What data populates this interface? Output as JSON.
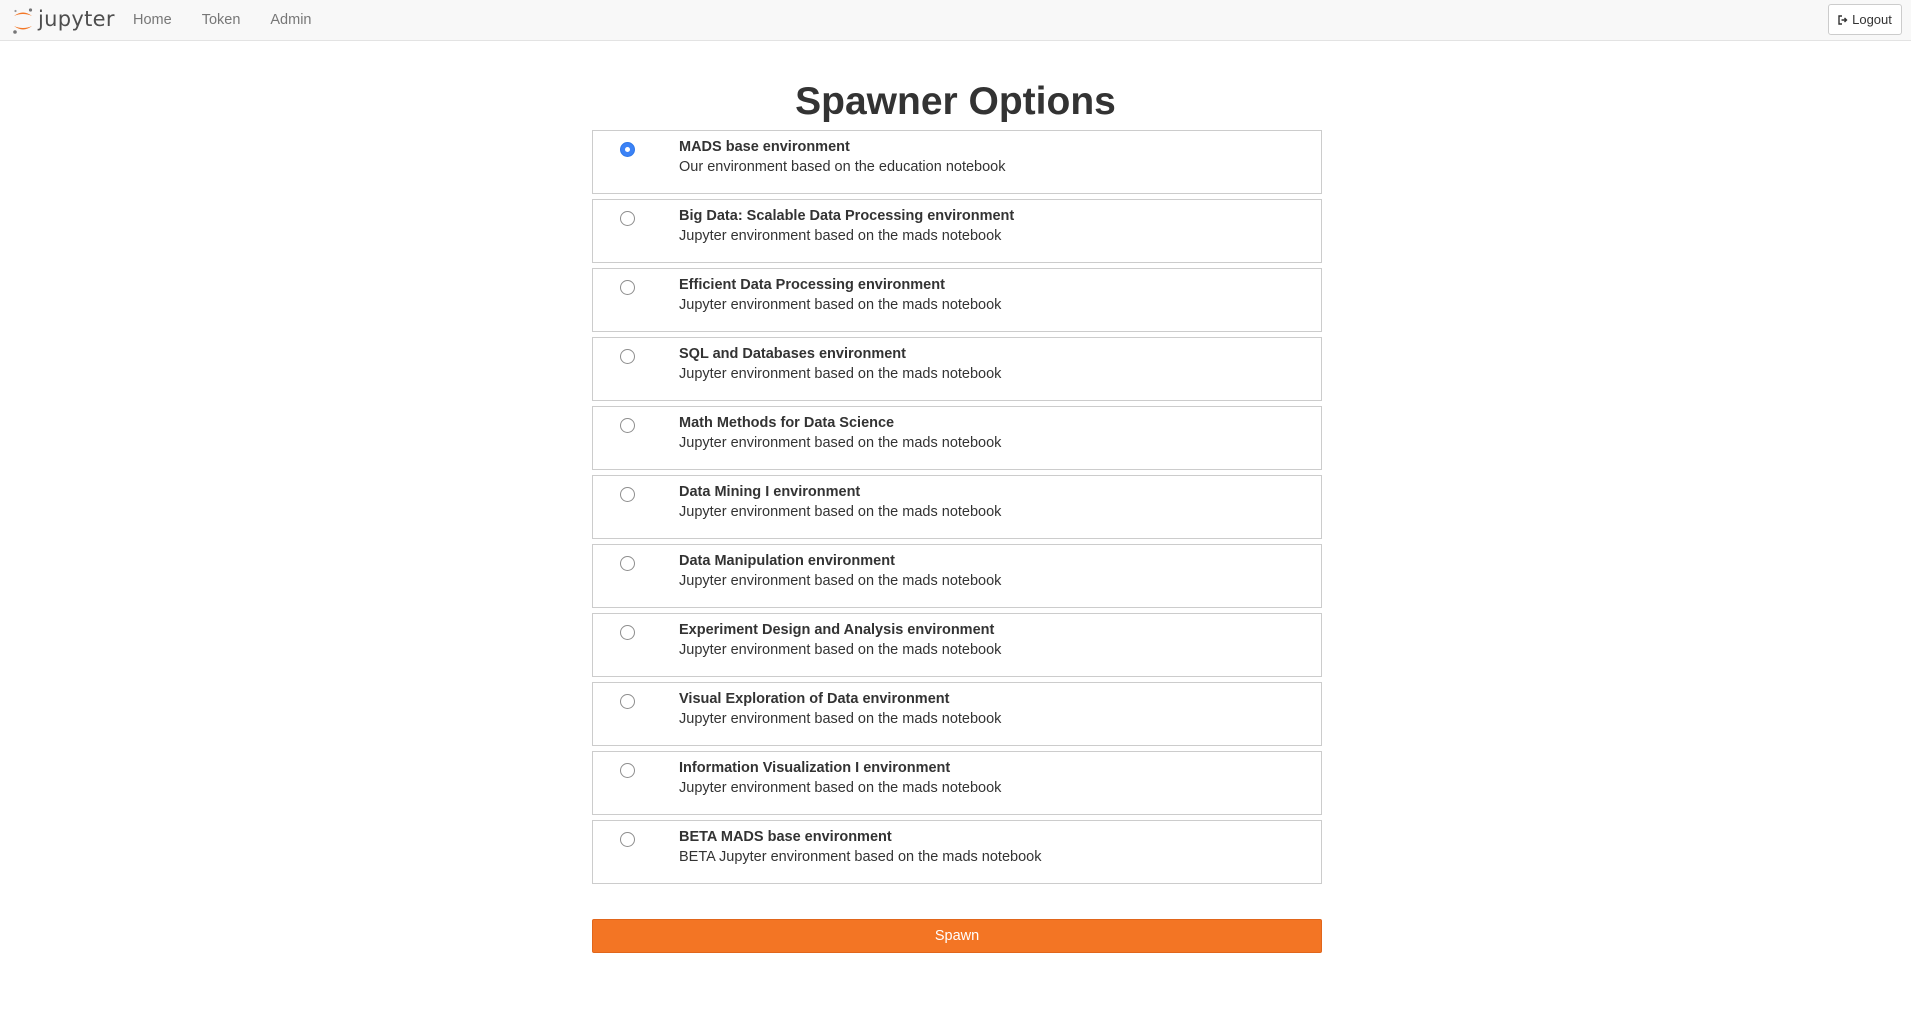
{
  "navbar": {
    "brand_text": "jupyter",
    "brand_color": "#f37726",
    "links": [
      {
        "label": "Home"
      },
      {
        "label": "Token"
      },
      {
        "label": "Admin"
      }
    ],
    "logout_label": "Logout",
    "logout_icon": "sign-out-icon"
  },
  "main": {
    "title": "Spawner Options",
    "selected_index": 0,
    "options": [
      {
        "title": "MADS base environment",
        "description": "Our environment based on the education notebook",
        "selected": true
      },
      {
        "title": "Big Data: Scalable Data Processing environment",
        "description": "Jupyter environment based on the mads notebook",
        "selected": false
      },
      {
        "title": "Efficient Data Processing environment",
        "description": "Jupyter environment based on the mads notebook",
        "selected": false
      },
      {
        "title": "SQL and Databases environment",
        "description": "Jupyter environment based on the mads notebook",
        "selected": false
      },
      {
        "title": "Math Methods for Data Science",
        "description": "Jupyter environment based on the mads notebook",
        "selected": false
      },
      {
        "title": "Data Mining I environment",
        "description": "Jupyter environment based on the mads notebook",
        "selected": false
      },
      {
        "title": "Data Manipulation environment",
        "description": "Jupyter environment based on the mads notebook",
        "selected": false
      },
      {
        "title": "Experiment Design and Analysis environment",
        "description": "Jupyter environment based on the mads notebook",
        "selected": false
      },
      {
        "title": "Visual Exploration of Data environment",
        "description": "Jupyter environment based on the mads notebook",
        "selected": false
      },
      {
        "title": "Information Visualization I environment",
        "description": "Jupyter environment based on the mads notebook",
        "selected": false
      },
      {
        "title": "BETA MADS base environment",
        "description": "BETA Jupyter environment based on the mads notebook",
        "selected": false
      }
    ],
    "spawn_label": "Spawn",
    "spawn_color": "#f37524"
  }
}
